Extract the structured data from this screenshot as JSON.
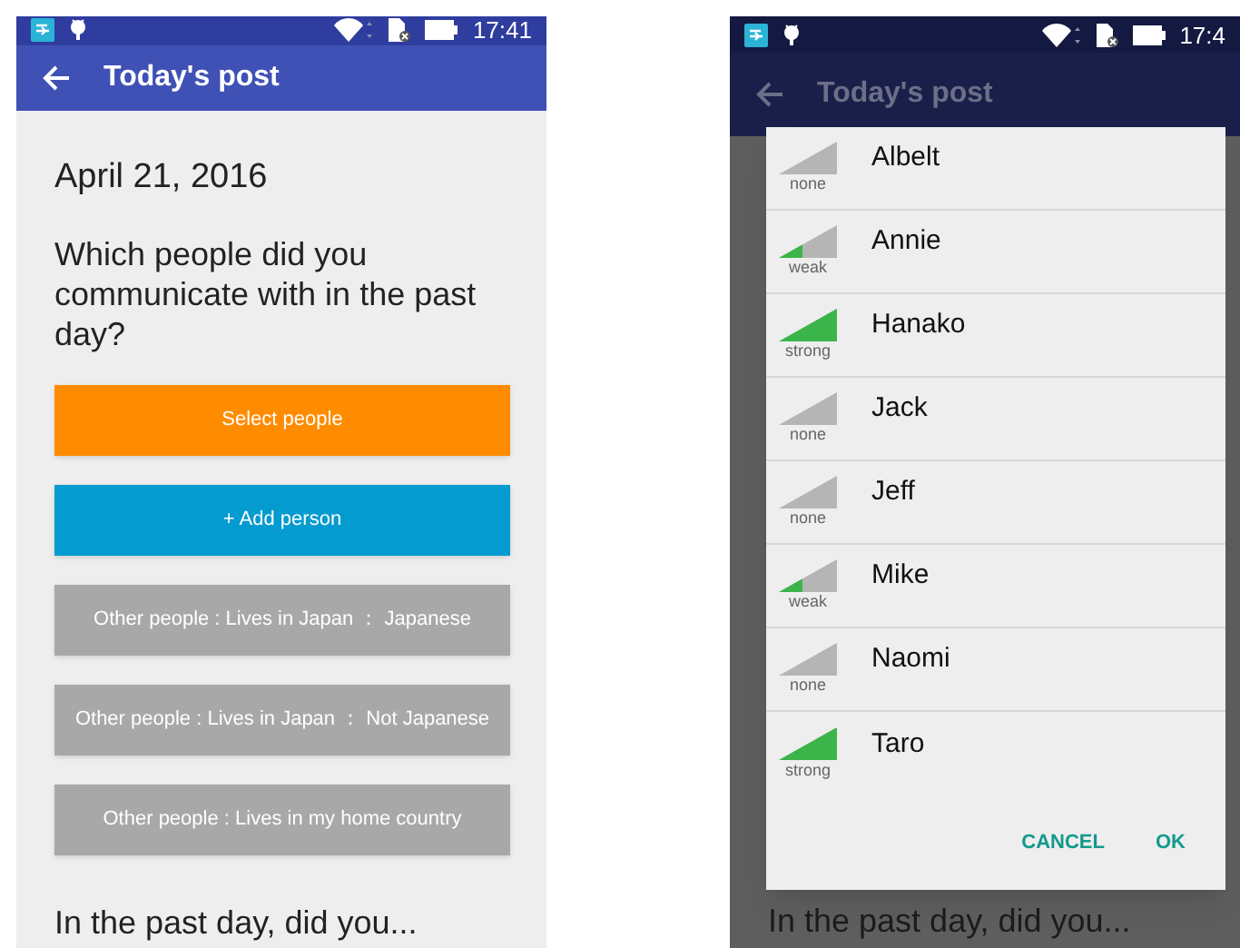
{
  "screens": [
    {
      "dimmed": false,
      "status_bar": {
        "time": "17:41"
      },
      "app_bar": {
        "title": "Today's post"
      },
      "date": "April 21, 2016",
      "question": "Which people did you communicate with in the past day?",
      "buttons": [
        {
          "label": "Select people",
          "kind": "primary"
        },
        {
          "label": "+ Add person",
          "kind": "add"
        },
        {
          "label": "Other people : Lives in Japan ： Japanese",
          "kind": "category"
        },
        {
          "label": "Other people : Lives in Japan ： Not Japanese",
          "kind": "category"
        },
        {
          "label": "Other people : Lives in my home country",
          "kind": "category"
        }
      ],
      "next_question": "In the past day, did you..."
    },
    {
      "dimmed": true,
      "status_bar": {
        "time": "17:4"
      },
      "app_bar": {
        "title": "Today's post"
      },
      "dialog": {
        "people": [
          {
            "name": "Albelt",
            "strength": "none",
            "level": 0
          },
          {
            "name": "Annie",
            "strength": "weak",
            "level": 0.4
          },
          {
            "name": "Hanako",
            "strength": "strong",
            "level": 1
          },
          {
            "name": "Jack",
            "strength": "none",
            "level": 0
          },
          {
            "name": "Jeff",
            "strength": "none",
            "level": 0
          },
          {
            "name": "Mike",
            "strength": "weak",
            "level": 0.4
          },
          {
            "name": "Naomi",
            "strength": "none",
            "level": 0
          },
          {
            "name": "Taro",
            "strength": "strong",
            "level": 1
          }
        ],
        "actions": [
          "CANCEL",
          "OK"
        ]
      },
      "next_question": "In the past day, did you..."
    }
  ]
}
